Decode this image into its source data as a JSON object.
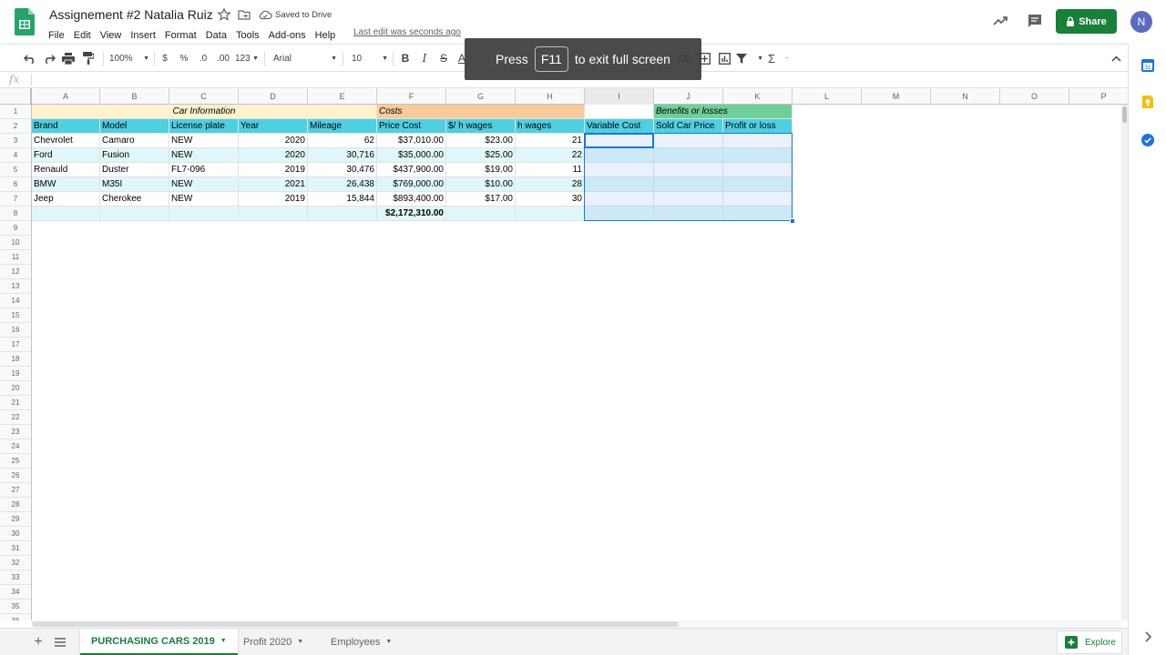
{
  "header": {
    "doc_title": "Assignement #2 Natalia Ruiz",
    "saved_status": "Saved to Drive",
    "last_edit": "Last edit was seconds ago",
    "share_label": "Share",
    "avatar_initial": "N",
    "menu": [
      "File",
      "Edit",
      "View",
      "Insert",
      "Format",
      "Data",
      "Tools",
      "Add-ons",
      "Help"
    ]
  },
  "toolbar": {
    "zoom": "100%",
    "currency": "$",
    "percent": "%",
    "dec_decrease": ".0",
    "dec_increase": ".00",
    "more_formats": "123",
    "font": "Arial",
    "font_size": "10",
    "bold": "B",
    "italic": "I",
    "strike": "S",
    "text_color": "A",
    "sum": "Σ"
  },
  "formula_bar": {
    "fx": "fx",
    "value": ""
  },
  "toast": {
    "prefix": "Press",
    "key": "F11",
    "suffix": "to exit full screen"
  },
  "columns": [
    "A",
    "B",
    "C",
    "D",
    "E",
    "F",
    "G",
    "H",
    "I",
    "J",
    "K",
    "L",
    "M",
    "N",
    "O",
    "P"
  ],
  "rows": [
    "1",
    "2",
    "3",
    "4",
    "5",
    "6",
    "7",
    "8",
    "9",
    "10",
    "11",
    "12",
    "13",
    "14",
    "15",
    "16",
    "17",
    "18",
    "19",
    "20",
    "21",
    "22",
    "23",
    "24",
    "25",
    "26",
    "27",
    "28",
    "29",
    "30",
    "31",
    "32",
    "33",
    "34",
    "35",
    "36"
  ],
  "sheet": {
    "group_headers": {
      "car_information": "Car Information",
      "costs": "Costs",
      "benefits": "Benefits or losses"
    },
    "column_headers": [
      "Brand",
      "Model",
      "License plate",
      "Year",
      "Mileage",
      "Price Cost",
      "$/ h wages",
      "h wages",
      "Variable Cost",
      "Sold Car Price",
      "Profit or loss"
    ],
    "data_rows": [
      [
        "Chevrolet",
        "Camaro",
        "NEW",
        "2020",
        "62",
        "$37,010.00",
        "$23.00",
        "21"
      ],
      [
        "Ford",
        "Fusion",
        "NEW",
        "2020",
        "30,716",
        "$35,000.00",
        "$25.00",
        "22"
      ],
      [
        "Renauld",
        "Duster",
        "FL7-096",
        "2019",
        "30,476",
        "$437,900.00",
        "$19.00",
        "11"
      ],
      [
        "BMW",
        "M35I",
        "NEW",
        "2021",
        "26,438",
        "$769,000.00",
        "$10.00",
        "28"
      ],
      [
        "Jeep",
        "Cherokee",
        "NEW",
        "2019",
        "15,844",
        "$893,400.00",
        "$17.00",
        "30"
      ]
    ],
    "total_price_cost": "$2,172,310.00"
  },
  "tabs": {
    "sheets": [
      "PURCHASING CARS 2019",
      "Profit 2020",
      "Employees"
    ],
    "active_index": 0,
    "explore_label": "Explore"
  },
  "colors": {
    "car_info_fill": "#fff2cc",
    "costs_fill": "#f9cb9c",
    "benefits_fill": "#6fcf97",
    "header_row_fill": "#4dd0e1",
    "band_fill": "#e0f7fa",
    "selection": "#1a73e8",
    "share_green": "#188038"
  },
  "icons": {
    "header": [
      "star-icon",
      "move-to-folder-icon",
      "cloud-saved-icon",
      "trending-icon",
      "comment-icon",
      "lock-icon"
    ],
    "toolbar": [
      "undo-icon",
      "redo-icon",
      "print-icon",
      "paint-format-icon",
      "link-icon",
      "insert-comment-icon",
      "insert-chart-icon",
      "filter-icon",
      "collapse-toolbar-icon"
    ],
    "side": [
      "calendar-icon",
      "keep-icon",
      "tasks-icon"
    ]
  }
}
